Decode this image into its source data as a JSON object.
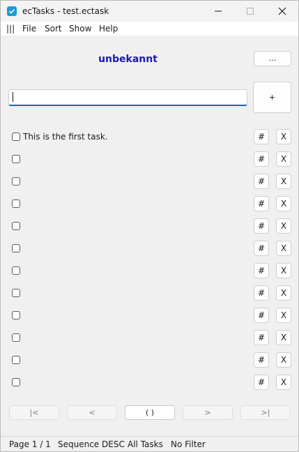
{
  "window": {
    "title": "ecTasks - test.ectask"
  },
  "menu": {
    "hamburger": "|||",
    "items": [
      "File",
      "Sort",
      "Show",
      "Help"
    ]
  },
  "header": {
    "label": "unbekannt",
    "more_label": "...",
    "accent": "#1a1ab5"
  },
  "input": {
    "value": "",
    "placeholder": ""
  },
  "add_button": {
    "label": "+"
  },
  "tasks": [
    {
      "text": "This is the first task.",
      "checked": false
    },
    {
      "text": "",
      "checked": false
    },
    {
      "text": "",
      "checked": false
    },
    {
      "text": "",
      "checked": false
    },
    {
      "text": "",
      "checked": false
    },
    {
      "text": "",
      "checked": false
    },
    {
      "text": "",
      "checked": false
    },
    {
      "text": "",
      "checked": false
    },
    {
      "text": "",
      "checked": false
    },
    {
      "text": "",
      "checked": false
    },
    {
      "text": "",
      "checked": false
    },
    {
      "text": "",
      "checked": false
    }
  ],
  "task_buttons": {
    "hash": "#",
    "delete": "X"
  },
  "pager": {
    "first": "|<",
    "prev": "<",
    "current": "(  )",
    "next": ">",
    "last": ">|"
  },
  "status": {
    "page": "Page 1 / 1",
    "sequence": "Sequence DESC",
    "filter_scope": "All Tasks",
    "filter": "No Filter"
  }
}
